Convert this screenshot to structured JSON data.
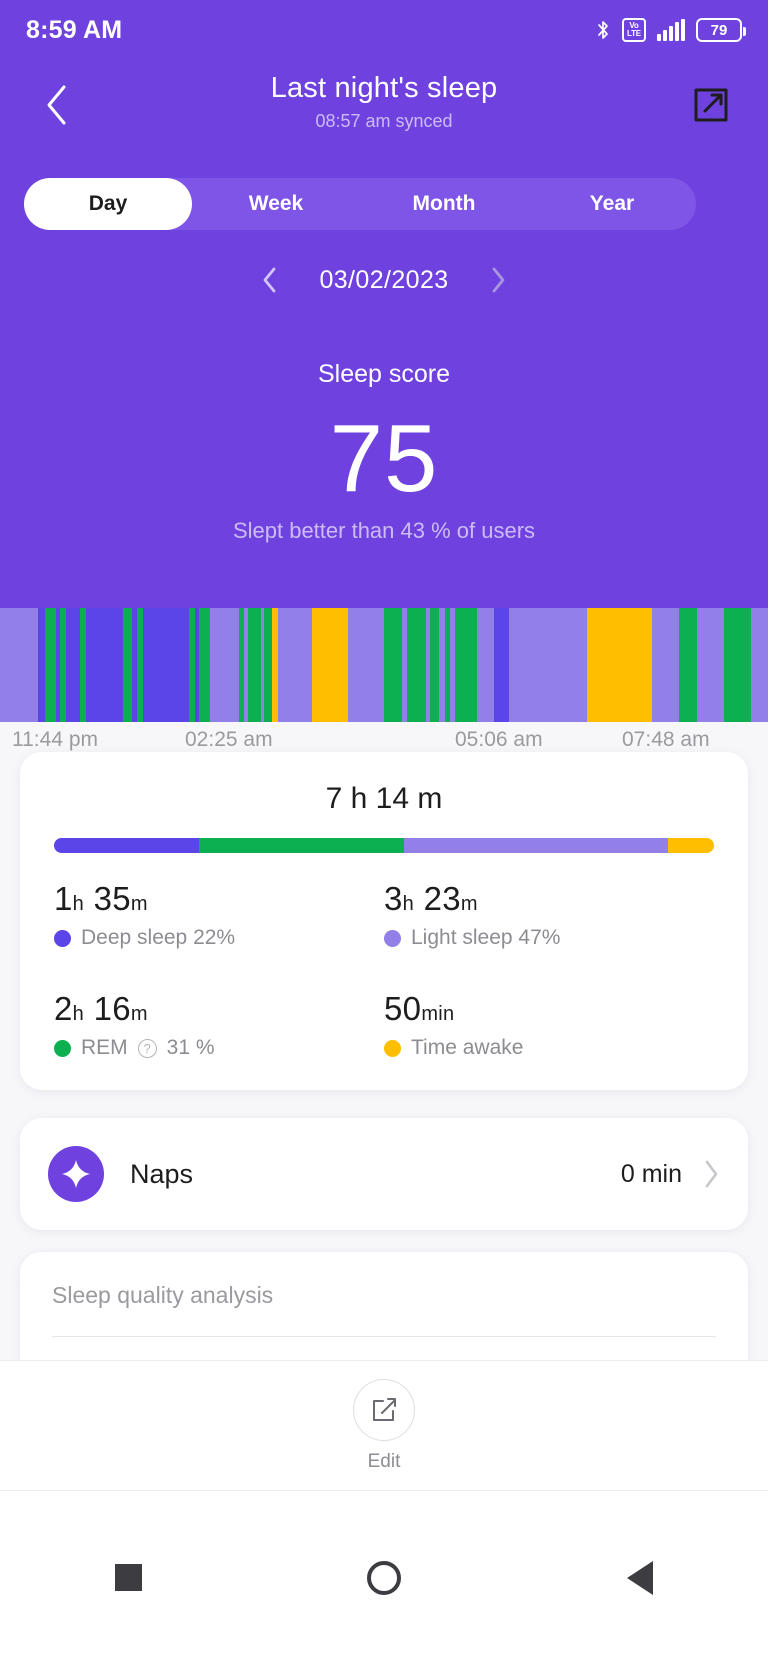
{
  "status_bar": {
    "time": "8:59 AM",
    "battery_percent": "79",
    "volte_top": "Vo",
    "volte_bottom": "LTE",
    "icons": [
      "bluetooth-icon",
      "volte-icon",
      "signal-bars-icon",
      "battery-icon"
    ]
  },
  "header": {
    "title": "Last night's sleep",
    "subtitle": "08:57 am synced",
    "back_icon": "back-chevron-icon",
    "share_icon": "share-external-icon"
  },
  "tabs": [
    {
      "label": "Day",
      "active": true
    },
    {
      "label": "Week",
      "active": false
    },
    {
      "label": "Month",
      "active": false
    },
    {
      "label": "Year",
      "active": false
    }
  ],
  "date_nav": {
    "prev_icon": "chevron-left-icon",
    "date": "03/02/2023",
    "next_icon": "chevron-right-icon"
  },
  "sleep_score": {
    "label": "Sleep score",
    "value": "75",
    "comparison": "Slept better than 43 % of users"
  },
  "colors": {
    "hero_purple": "#6f42e0",
    "deep": "#5b44e8",
    "rem": "#0cb050",
    "light": "#9280e8",
    "awake": "#ffbe00",
    "card_white": "#ffffff",
    "page_bg": "#f7f7fa"
  },
  "chart_data": {
    "type": "bar",
    "title": "Sleep stage hypnogram",
    "xlabel": "",
    "ylabel": "",
    "grid": false,
    "legend_position": "below-in-stats-card",
    "axis_ticks": [
      "11:44 pm",
      "02:25 am",
      "05:06 am",
      "07:48 am"
    ],
    "x_range": [
      "11:44 pm",
      "07:48 am"
    ],
    "stage_colors": {
      "deep": "#5b44e8",
      "rem": "#0cb050",
      "light": "#9280e8",
      "awake": "#ffbe00"
    },
    "segments": [
      {
        "stage": "light",
        "width": 4.6
      },
      {
        "stage": "deep",
        "width": 0.9
      },
      {
        "stage": "rem",
        "width": 1.4
      },
      {
        "stage": "deep",
        "width": 0.5
      },
      {
        "stage": "rem",
        "width": 0.7
      },
      {
        "stage": "deep",
        "width": 1.7
      },
      {
        "stage": "rem",
        "width": 0.7
      },
      {
        "stage": "deep",
        "width": 4.5
      },
      {
        "stage": "rem",
        "width": 1.2
      },
      {
        "stage": "deep",
        "width": 0.5
      },
      {
        "stage": "rem",
        "width": 0.8
      },
      {
        "stage": "deep",
        "width": 5.6
      },
      {
        "stage": "rem",
        "width": 0.8
      },
      {
        "stage": "deep",
        "width": 0.5
      },
      {
        "stage": "rem",
        "width": 1.3
      },
      {
        "stage": "light",
        "width": 3.5
      },
      {
        "stage": "rem",
        "width": 0.7
      },
      {
        "stage": "light",
        "width": 0.4
      },
      {
        "stage": "rem",
        "width": 1.6
      },
      {
        "stage": "light",
        "width": 0.4
      },
      {
        "stage": "rem",
        "width": 1.0
      },
      {
        "stage": "awake",
        "width": 0.7
      },
      {
        "stage": "light",
        "width": 4.2
      },
      {
        "stage": "awake",
        "width": 4.4
      },
      {
        "stage": "light",
        "width": 4.4
      },
      {
        "stage": "rem",
        "width": 2.2
      },
      {
        "stage": "light",
        "width": 0.6
      },
      {
        "stage": "rem",
        "width": 2.3
      },
      {
        "stage": "light",
        "width": 0.5
      },
      {
        "stage": "rem",
        "width": 1.1
      },
      {
        "stage": "light",
        "width": 0.7
      },
      {
        "stage": "rem",
        "width": 0.7
      },
      {
        "stage": "light",
        "width": 0.6
      },
      {
        "stage": "rem",
        "width": 2.7
      },
      {
        "stage": "light",
        "width": 2.0
      },
      {
        "stage": "deep",
        "width": 1.9
      },
      {
        "stage": "light",
        "width": 9.5
      },
      {
        "stage": "awake",
        "width": 7.9
      },
      {
        "stage": "light",
        "width": 3.4
      },
      {
        "stage": "rem",
        "width": 2.2
      },
      {
        "stage": "light",
        "width": 3.3
      },
      {
        "stage": "rem",
        "width": 3.2
      },
      {
        "stage": "light",
        "width": 2.1
      }
    ]
  },
  "stats_card": {
    "total_duration": "7 h 14 m",
    "stack_bar": [
      {
        "stage": "deep",
        "percent": 22
      },
      {
        "stage": "rem",
        "percent": 31
      },
      {
        "stage": "light",
        "percent": 40
      },
      {
        "stage": "awake",
        "percent": 7
      }
    ],
    "items": [
      {
        "value_num1": "1",
        "unit1": "h",
        "value_num2": "35",
        "unit2": "m",
        "label": "Deep sleep 22%",
        "color": "#5b44e8",
        "has_help_icon": false,
        "name": "deep-sleep"
      },
      {
        "value_num1": "3",
        "unit1": "h",
        "value_num2": "23",
        "unit2": "m",
        "label": "Light sleep 47%",
        "color": "#9280e8",
        "has_help_icon": false,
        "name": "light-sleep"
      },
      {
        "value_num1": "2",
        "unit1": "h",
        "value_num2": "16",
        "unit2": "m",
        "label_before": "REM",
        "label_after": "31 %",
        "label": "REM 31 %",
        "color": "#0cb050",
        "has_help_icon": true,
        "name": "rem-sleep"
      },
      {
        "value_num1": "50",
        "unit1": "min",
        "value_num2": "",
        "unit2": "",
        "label": "Time awake",
        "color": "#ffbe00",
        "has_help_icon": false,
        "name": "time-awake"
      }
    ]
  },
  "naps": {
    "icon": "sparkle-star-icon",
    "label": "Naps",
    "value": "0 min",
    "chevron": "chevron-right-icon"
  },
  "analysis": {
    "title": "Sleep quality analysis"
  },
  "edit_bar": {
    "icon": "edit-pencil-square-icon",
    "label": "Edit"
  },
  "nav_bar": {
    "recents": "recents-square-icon",
    "home": "home-circle-icon",
    "back": "back-triangle-icon"
  }
}
